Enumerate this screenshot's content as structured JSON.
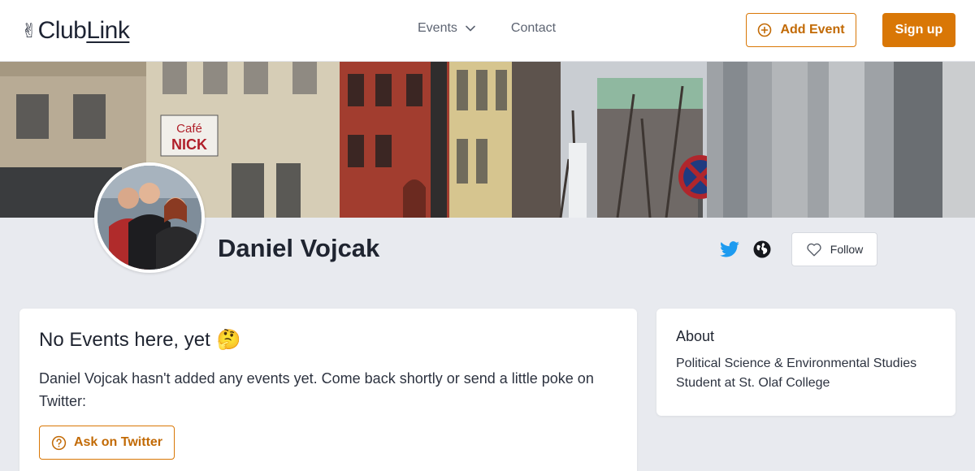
{
  "header": {
    "logo_hand": "✌",
    "logo_part1": "Club",
    "logo_part2": "Link",
    "nav": {
      "events_label": "Events",
      "contact_label": "Contact"
    },
    "add_event_label": "Add Event",
    "signup_label": "Sign up"
  },
  "banner": {
    "sign_line1": "Café",
    "sign_line2": "NICK"
  },
  "profile": {
    "name": "Daniel Vojcak",
    "follow_label": "Follow"
  },
  "events": {
    "title": "No Events here, yet",
    "emoji": "🤔",
    "message": "Daniel Vojcak hasn't added any events yet. Come back shortly or send a little poke on Twitter:",
    "ask_label": "Ask on Twitter"
  },
  "about": {
    "title": "About",
    "text": "Political Science & Environmental Studies Student at St. Olaf College"
  },
  "colors": {
    "accent": "#d97706",
    "twitter": "#1d9bf0",
    "page_bg": "#e8eaef"
  }
}
